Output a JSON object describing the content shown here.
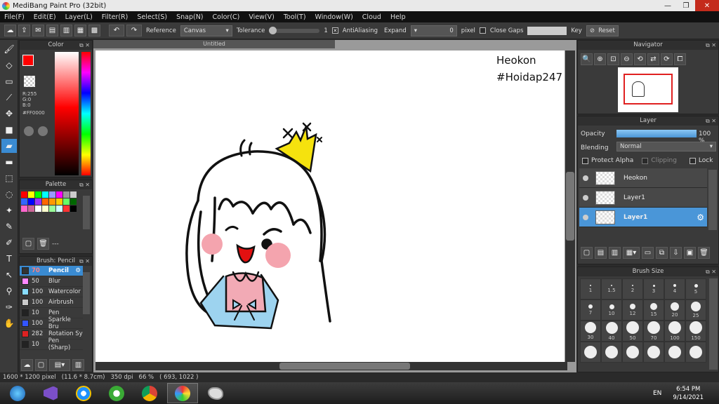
{
  "window": {
    "title": "MediBang Paint Pro (32bit)"
  },
  "menu": [
    "File(F)",
    "Edit(E)",
    "Layer(L)",
    "Filter(R)",
    "Select(S)",
    "Snap(N)",
    "Color(C)",
    "View(V)",
    "Tool(T)",
    "Window(W)",
    "Cloud",
    "Help"
  ],
  "toolbar": {
    "reference_label": "Reference",
    "reference_value": "Canvas",
    "tolerance_label": "Tolerance",
    "tolerance_value": "1",
    "antialiasing_label": "AntiAliasing",
    "expand_label": "Expand",
    "expand_value": "0",
    "expand_unit": "pixel",
    "close_gaps_label": "Close Gaps",
    "key_label": "Key",
    "reset_label": "Reset"
  },
  "color_panel": {
    "title": "Color",
    "r": "R:255",
    "g": "G:0",
    "b": "B:0",
    "hex": "#FF0000"
  },
  "palette_panel": {
    "title": "Palette",
    "footer_text": "---",
    "swatches": [
      "#ff0000",
      "#ffff00",
      "#00ff00",
      "#00ffff",
      "#9999ff",
      "#ff00ff",
      "#999999",
      "#cccccc",
      "#3366ff",
      "#0000ff",
      "#9933ff",
      "#ff6600",
      "#ff9900",
      "#ffcc00",
      "#66ff66",
      "#006600",
      "#ff66cc",
      "#cc6699",
      "#ffffff",
      "#ffffcc",
      "#99ff99",
      "#ccffff",
      "#ff3333",
      "#000000"
    ]
  },
  "brush_panel": {
    "title": "Brush: Pencil",
    "items": [
      {
        "size": "70",
        "name": "Pencil",
        "color": "#333333"
      },
      {
        "size": "50",
        "name": "Blur",
        "color": "#ff88ff"
      },
      {
        "size": "100",
        "name": "Watercolor",
        "color": "#88ddff"
      },
      {
        "size": "100",
        "name": "Airbrush",
        "color": "#cccccc"
      },
      {
        "size": "10",
        "name": "Pen",
        "color": "#222222"
      },
      {
        "size": "100",
        "name": "Sparkle Bru",
        "color": "#3355ff"
      },
      {
        "size": "282",
        "name": "Rotation Sy",
        "color": "#dd2222"
      },
      {
        "size": "10",
        "name": "Pen (Sharp)",
        "color": "#222222"
      }
    ]
  },
  "canvas": {
    "tab_title": "Untitled",
    "text_line1": "Heokon",
    "text_line2": "#Hoidap247"
  },
  "navigator": {
    "title": "Navigator"
  },
  "layer_panel": {
    "title": "Layer",
    "opacity_label": "Opacity",
    "opacity_value": "100 %",
    "opacity": 1.0,
    "blending_label": "Blending",
    "blending_value": "Normal",
    "protect_alpha": "Protect Alpha",
    "clipping": "Clipping",
    "lock": "Lock",
    "layers": [
      {
        "name": "Heokon"
      },
      {
        "name": "Layer1"
      },
      {
        "name": "Layer1"
      }
    ]
  },
  "brush_size_panel": {
    "title": "Brush Size",
    "sizes": [
      "1",
      "1.5",
      "2",
      "3",
      "4",
      "5",
      "7",
      "10",
      "12",
      "15",
      "20",
      "25",
      "30",
      "40",
      "50",
      "70",
      "100",
      "150"
    ]
  },
  "status": {
    "size": "1600 * 1200 pixel",
    "dim": "(11.6 * 8.7cm)",
    "dpi": "350 dpi",
    "zoom": "66 %",
    "coords": "( 693, 1022 )"
  },
  "taskbar": {
    "lang": "EN",
    "time": "6:54 PM",
    "date": "9/14/2021"
  }
}
